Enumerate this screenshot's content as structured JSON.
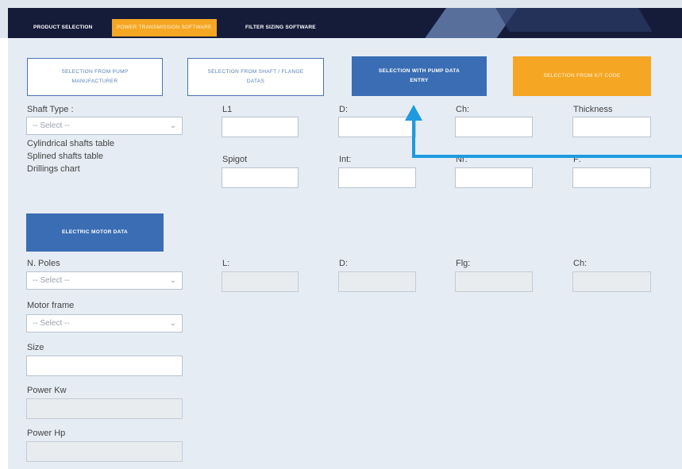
{
  "nav": {
    "items": [
      {
        "label": "PRODUCT SELECTION"
      },
      {
        "label": "POWER TRANSMISSION SOFTWARE"
      },
      {
        "label": "FILTER SIZING SOFTWARE"
      }
    ]
  },
  "mode_buttons": {
    "pump_manufacturer": {
      "line1": "SELECTION FROM PUMP",
      "line2": "MANUFACTURER"
    },
    "shaft_flange": {
      "line1": "SELECTION FROM SHAFT / FLANGE",
      "line2": "DATAS"
    },
    "pump_data_entry": {
      "line1": "SELECTION WITH PUMP DATA",
      "line2": "ENTRY"
    },
    "kit_code": {
      "label": "SELECTION FROM KIT CODE"
    }
  },
  "shaft": {
    "type_label": "Shaft Type :",
    "select_value": "-- Select --",
    "links": [
      "Cylindrical shafts table",
      "Splined shafts table",
      "Drillings chart"
    ]
  },
  "pump_fields": {
    "row1": [
      "L1",
      "D:",
      "Ch:",
      "Thickness"
    ],
    "row2": [
      "Spigot",
      "Int:",
      "Nr:",
      "F:"
    ]
  },
  "motor": {
    "button_label": "ELECTRIC MOTOR DATA",
    "poles_label": "N. Poles",
    "poles_value": "-- Select --",
    "frame_label": "Motor frame",
    "frame_value": "-- Select --",
    "size_label": "Size",
    "power_kw_label": "Power Kw",
    "power_hp_label": "Power Hp",
    "fields": [
      "L:",
      "D:",
      "Flg:",
      "Ch:"
    ]
  },
  "colors": {
    "nav_bg": "#151c3a",
    "accent_orange": "#f5a623",
    "accent_blue": "#3a6db4",
    "arrow": "#1e9be0"
  }
}
